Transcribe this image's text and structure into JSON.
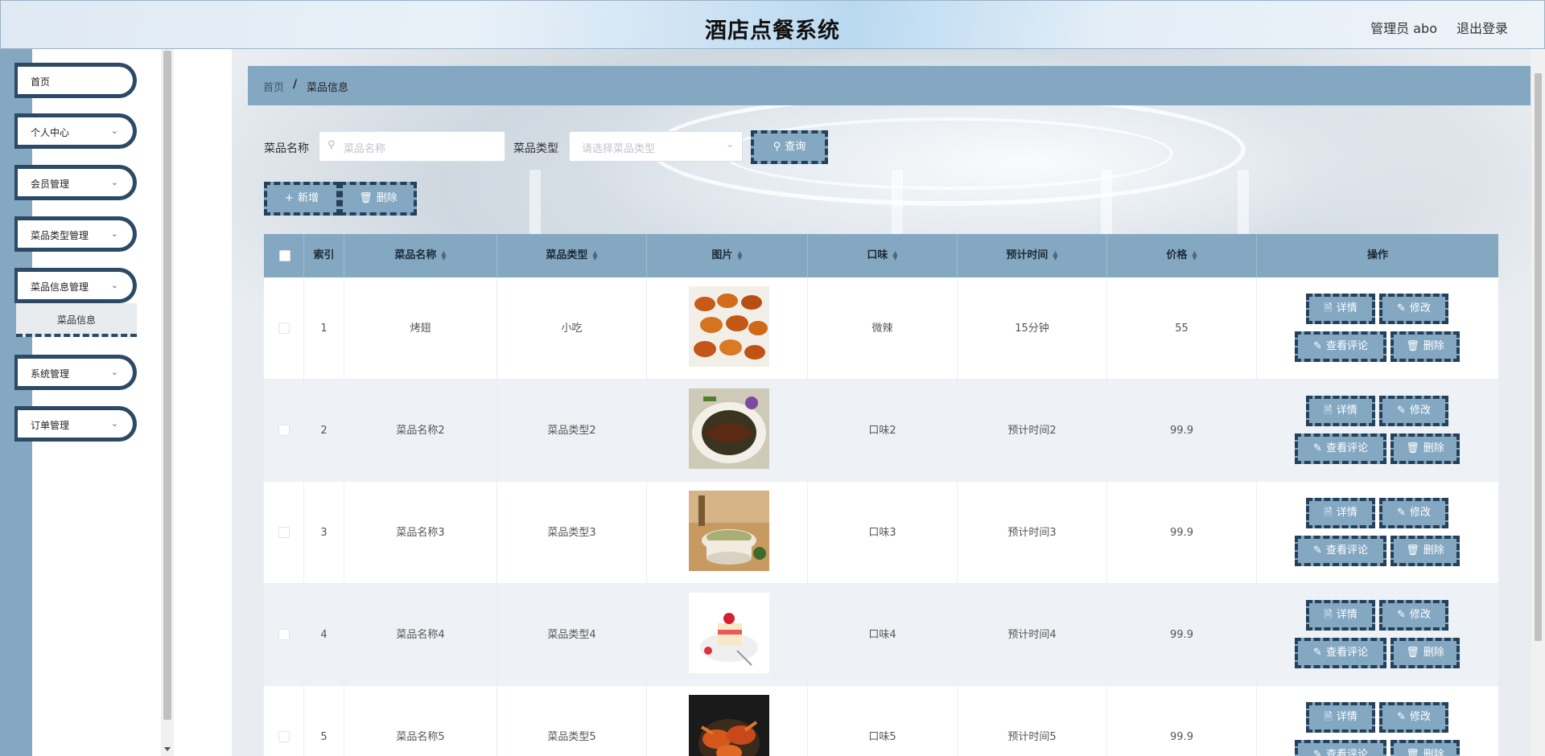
{
  "header": {
    "title": "酒店点餐系统",
    "user": "管理员 abo",
    "logout": "退出登录"
  },
  "sidebar": {
    "items": [
      {
        "label": "首页",
        "has_children": false
      },
      {
        "label": "个人中心",
        "has_children": true
      },
      {
        "label": "会员管理",
        "has_children": true
      },
      {
        "label": "菜品类型管理",
        "has_children": true
      },
      {
        "label": "菜品信息管理",
        "has_children": true
      },
      {
        "label": "系统管理",
        "has_children": true
      },
      {
        "label": "订单管理",
        "has_children": true
      }
    ],
    "sub_active": "菜品信息"
  },
  "breadcrumb": {
    "home": "首页",
    "separator": "/",
    "current": "菜品信息"
  },
  "search": {
    "name_label": "菜品名称",
    "name_placeholder": "菜品名称",
    "type_label": "菜品类型",
    "type_placeholder": "请选择菜品类型",
    "query_button": "查询"
  },
  "toolbar": {
    "add_button": "新增",
    "delete_button": "删除"
  },
  "table": {
    "columns": [
      "索引",
      "菜品名称",
      "菜品类型",
      "图片",
      "口味",
      "预计时间",
      "价格",
      "操作"
    ],
    "actions": {
      "detail": "详情",
      "edit": "修改",
      "comments": "查看评论",
      "delete": "删除"
    },
    "rows": [
      {
        "index": "1",
        "name": "烤翅",
        "type": "小吃",
        "taste": "微辣",
        "time": "15分钟",
        "price": "55",
        "image": "roast-wings"
      },
      {
        "index": "2",
        "name": "菜品名称2",
        "type": "菜品类型2",
        "taste": "口味2",
        "time": "预计时间2",
        "price": "99.9",
        "image": "braised-dish"
      },
      {
        "index": "3",
        "name": "菜品名称3",
        "type": "菜品类型3",
        "taste": "口味3",
        "time": "预计时间3",
        "price": "99.9",
        "image": "soup-bowl"
      },
      {
        "index": "4",
        "name": "菜品名称4",
        "type": "菜品类型4",
        "taste": "口味4",
        "time": "预计时间4",
        "price": "99.9",
        "image": "cake-dessert"
      },
      {
        "index": "5",
        "name": "菜品名称5",
        "type": "菜品类型5",
        "taste": "口味5",
        "time": "预计时间5",
        "price": "99.9",
        "image": "crab-dish"
      }
    ]
  },
  "colors": {
    "accent": "#84a8c2",
    "dash_border": "#25405a",
    "menu_border": "#2c4a66"
  }
}
